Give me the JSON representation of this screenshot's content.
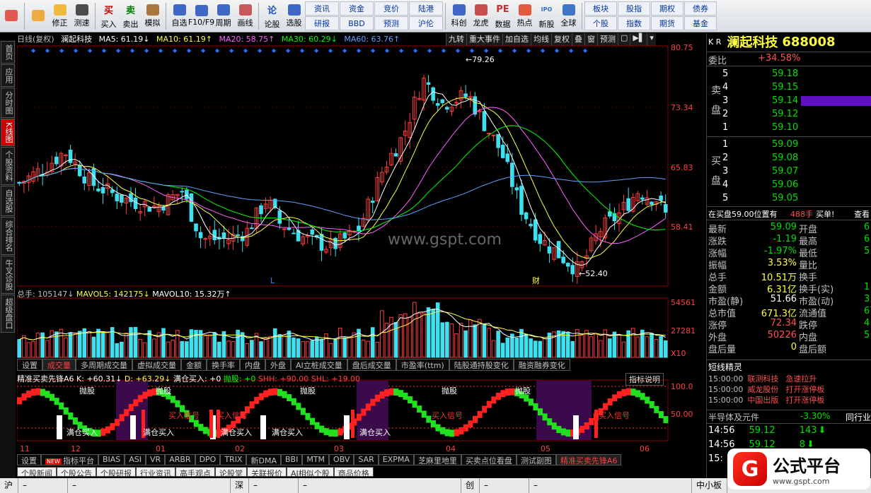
{
  "toolbar": {
    "items": [
      {
        "label": "",
        "icon": "windows-logo-icon",
        "color": "#e04030"
      },
      {
        "label": "",
        "icon": "back-arrow-icon",
        "color": "#f0a020"
      },
      {
        "label": "修正",
        "icon": "up-down-icon",
        "color": "#f0b020"
      },
      {
        "label": "测速",
        "icon": "clock-icon",
        "color": "#303030"
      },
      {
        "label": "买入",
        "icon": "buy-icon",
        "glyph": "买",
        "color": "#d00000"
      },
      {
        "label": "卖出",
        "icon": "sell-icon",
        "glyph": "卖",
        "color": "#008000"
      },
      {
        "label": "模拟",
        "icon": "hammer-icon",
        "color": "#a06020"
      },
      {
        "label": "自选",
        "icon": "star-icon",
        "color": "#2050c0"
      },
      {
        "label": "F10/F9",
        "icon": "f10-icon",
        "color": "#2050c0"
      },
      {
        "label": "周期",
        "icon": "cycle-icon",
        "color": "#2050c0"
      },
      {
        "label": "画线",
        "icon": "pencil-icon",
        "color": "#c04040"
      },
      {
        "label": "论股",
        "icon": "discuss-icon",
        "glyph": "论",
        "color": "#2050c0"
      },
      {
        "label": "选股",
        "icon": "select-stock-icon",
        "color": "#2050c0"
      }
    ],
    "grid1": [
      "资讯",
      "资金",
      "竞价",
      "陆港",
      "研报",
      "BBD",
      "预测",
      "沪伦"
    ],
    "items2": [
      {
        "label": "科创",
        "icon": "chart-icon",
        "color": "#2050c0"
      },
      {
        "label": "龙虎",
        "icon": "dragon-icon",
        "color": "#c03030"
      },
      {
        "label": "数据",
        "icon": "pe-icon",
        "glyph": "PE",
        "color": "#c03030"
      },
      {
        "label": "热点",
        "icon": "hot-icon",
        "color": "#e04020"
      },
      {
        "label": "新股",
        "icon": "ipo-icon",
        "glyph": "IPO",
        "color": "#3070c0"
      },
      {
        "label": "全球",
        "icon": "globe-icon",
        "color": "#2060c0"
      }
    ],
    "grid2": [
      "板块",
      "股指",
      "期权",
      "债券",
      "个股",
      "指数",
      "期货",
      "基金"
    ]
  },
  "left_tabs": [
    "首页",
    "应用",
    "分时图",
    "K线图",
    "个股资料",
    "自选股",
    "综合排名",
    "牛叉诊股",
    "超级盘口"
  ],
  "left_tab_active": "K线图",
  "header": {
    "line1": "日线(复权)",
    "stock": "澜起科技",
    "ma5": "MA5: 61.19↓",
    "ma10": "MA10: 61.19↑",
    "ma20": "MA20: 58.75↑",
    "ma30": "MA30: 60.29↓",
    "ma60": "MA60: 63.76↑"
  },
  "chart_buttons": [
    "九转",
    "重大事件",
    "加自选",
    "均线",
    "复权",
    "叠",
    "窗",
    "预测"
  ],
  "watermark": "www.gspt.com",
  "price_axis": [
    "80.75",
    "73.34",
    "65.83",
    "58.41"
  ],
  "price_marks": {
    "high": "79.26",
    "low": "52.40",
    "L": "L",
    "cai": "财"
  },
  "volume": {
    "header_label": "总手: 105147↓",
    "mavol5": "MAVOL5: 142175↓",
    "mavol10": "MAVOL10: 15.32万↑",
    "axis": [
      "54561",
      "27281",
      "X10"
    ]
  },
  "chart_tabs": [
    "设置",
    "成交量",
    "多周期成交量",
    "虚拟成交量",
    "金额",
    "换手率",
    "内盘",
    "外盘",
    "AI立桩成交量",
    "盘后成交量",
    "市盈率(ttm)",
    "陆股通持股变化",
    "融资融券变化"
  ],
  "chart_tab_active": "成交量",
  "indicator": {
    "name": "精准买卖先锋A6",
    "k": "K: +60.31↓",
    "d": "D: +63.29↓",
    "full": "满仓买入: +0",
    "sell": "抛股: +0",
    "shh": "SHH: +90.00",
    "shl": "SHL: +19.00",
    "explain": "指标说明",
    "axis": [
      "100.0",
      "50.00"
    ],
    "labels_top": [
      "抛股",
      "抛股",
      "抛股",
      "抛股",
      "抛股"
    ],
    "labels_buy": [
      "满仓买入",
      "满仓买入",
      "满仓买入",
      "满仓买入",
      "满仓买入"
    ],
    "labels_signal": [
      "买入信号",
      "买入信号",
      "买入信号",
      "买入信号"
    ]
  },
  "x_axis": [
    "11",
    "12",
    "01",
    "02",
    "03",
    "04",
    "05",
    "06"
  ],
  "bottom_tabs": [
    "设置",
    "指标平台",
    "BIAS",
    "ASI",
    "VR",
    "ARBR",
    "DPO",
    "TRIX",
    "新DMA",
    "BBI",
    "MTM",
    "OBV",
    "SAR",
    "EXPMA",
    "芝麻里地里",
    "买卖点位看盘",
    "测试副图",
    "精准买卖先锋A6"
  ],
  "bottom_tab_active": "精准买卖先锋A6",
  "bottom_new": "NEW",
  "bottom_tabs2": [
    "个股新闻",
    "个股公告",
    "个股研报",
    "行业资讯",
    "高手观点",
    "论股堂",
    "关联报价",
    "AI相似个股",
    "商品价格"
  ],
  "status_bar": [
    "沪",
    "–",
    "–",
    "深",
    "–",
    "–",
    "创",
    "–",
    "–",
    "中小板"
  ],
  "right_panel": {
    "kr": "K R",
    "name": "澜起科技",
    "code": "688008",
    "weibi_label": "委比",
    "weibi": "+34.58%",
    "sell_label": "卖盘",
    "buy_label": "买盘",
    "asks": [
      {
        "lv": "5",
        "p": "59.18",
        "v": ""
      },
      {
        "lv": "4",
        "p": "59.15",
        "v": ""
      },
      {
        "lv": "3",
        "p": "59.14",
        "v": ""
      },
      {
        "lv": "2",
        "p": "59.12",
        "v": ""
      },
      {
        "lv": "1",
        "p": "59.10",
        "v": ""
      }
    ],
    "bids": [
      {
        "lv": "1",
        "p": "59.09",
        "v": ""
      },
      {
        "lv": "2",
        "p": "59.08",
        "v": ""
      },
      {
        "lv": "3",
        "p": "59.07",
        "v": ""
      },
      {
        "lv": "4",
        "p": "59.06",
        "v": ""
      },
      {
        "lv": "5",
        "p": "59.05",
        "v": ""
      }
    ],
    "pos_text": "在买盘59.00位置有",
    "pos_vol": "488手",
    "pos_buy": "买单!",
    "pos_check": "查看",
    "stats": [
      {
        "l": "最新",
        "v": "59.09",
        "vc": "grn",
        "l2": "开盘",
        "v2": "6"
      },
      {
        "l": "涨跌",
        "v": "-1.19",
        "vc": "grn",
        "l2": "最高",
        "v2": "6"
      },
      {
        "l": "涨幅",
        "v": "-1.97%",
        "vc": "grn",
        "l2": "最低",
        "v2": "5"
      },
      {
        "l": "振幅",
        "v": "3.53%",
        "vc": "yel",
        "l2": "量比",
        "v2": ""
      },
      {
        "l": "总手",
        "v": "10.51万",
        "vc": "yel",
        "l2": "换手",
        "v2": ""
      },
      {
        "l": "金额",
        "v": "6.31亿",
        "vc": "yel",
        "l2": "换手(实)",
        "v2": "1"
      },
      {
        "l": "市盈(静)",
        "v": "51.66",
        "vc": "wht",
        "l2": "市盈(动)",
        "v2": "3"
      },
      {
        "l": "总市值",
        "v": "671.3亿",
        "vc": "yel",
        "l2": "流通值",
        "v2": "67"
      },
      {
        "l": "涨停",
        "v": "72.34",
        "vc": "red",
        "l2": "跌停",
        "v2": "4"
      },
      {
        "l": "外盘",
        "v": "50226",
        "vc": "red",
        "l2": "内盘",
        "v2": "5"
      },
      {
        "l": "盘后量",
        "v": "0",
        "vc": "yel",
        "l2": "盘后额",
        "v2": ""
      }
    ],
    "news_title": "短线精灵",
    "news": [
      {
        "t": "15:00:00",
        "n": "联测科技",
        "e": "急速拉升"
      },
      {
        "t": "15:00:00",
        "n": "威龙股份",
        "e": "打开涨停板"
      },
      {
        "t": "15:00:00",
        "n": "中国出版",
        "e": "打开涨停板"
      }
    ],
    "sector": "半导体及元件",
    "sector_chg": "-3.30%",
    "sector_btn": "同行业",
    "ticks": [
      {
        "t": "14:56",
        "p": "59.12",
        "v": "143"
      },
      {
        "t": "14:56",
        "p": "59.12",
        "v": "8"
      },
      {
        "t": "15:",
        "p": "",
        "v": ""
      }
    ]
  },
  "logo": {
    "text": "公式平台",
    "url": "www.gspt.com"
  },
  "colors": {
    "up": "#ff3b3b",
    "down": "#3ee0f0",
    "ma5": "#ffffff",
    "ma10": "#ffff40",
    "ma20": "#ff60ff",
    "ma30": "#00ff00",
    "ma60": "#60a0ff"
  }
}
